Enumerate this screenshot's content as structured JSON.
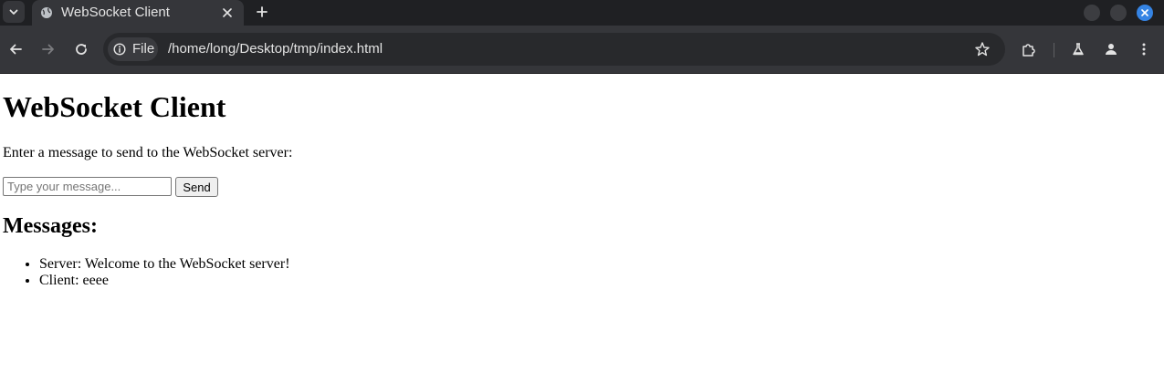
{
  "browser": {
    "tab": {
      "title": "WebSocket Client"
    },
    "address_bar": {
      "site_chip_label": "File",
      "url": "/home/long/Desktop/tmp/index.html"
    },
    "icons": [
      "tab-list-icon",
      "globe-icon",
      "close-icon",
      "plus-icon",
      "back-icon",
      "forward-icon",
      "reload-icon",
      "info-icon",
      "star-icon",
      "extensions-icon",
      "labs-icon",
      "profile-icon",
      "menu-icon"
    ],
    "accent_color": "#3584e4"
  },
  "page": {
    "title": "WebSocket Client",
    "prompt": "Enter a message to send to the WebSocket server:",
    "input": {
      "placeholder": "Type your message...",
      "value": ""
    },
    "send_label": "Send",
    "messages_heading": "Messages:",
    "messages": [
      "Server: Welcome to the WebSocket server!",
      "Client: eeee"
    ]
  }
}
